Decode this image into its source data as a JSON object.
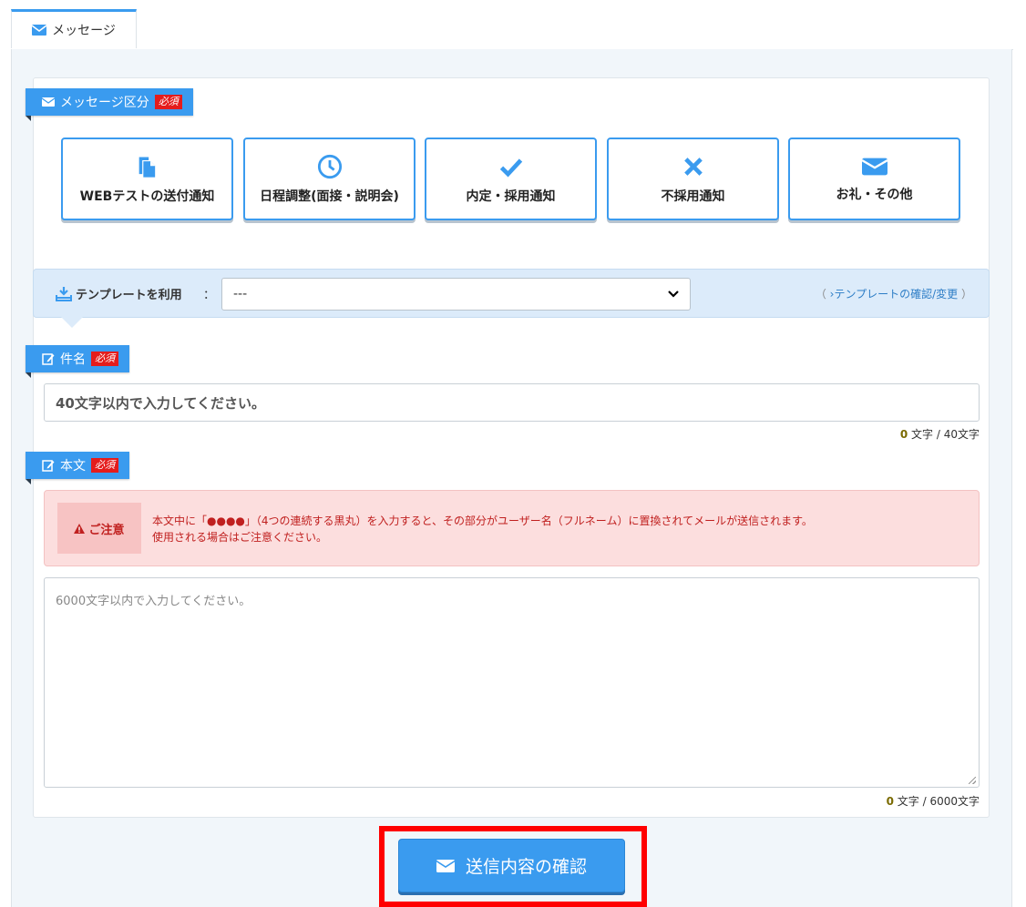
{
  "tabs": [
    {
      "label": "メッセージ",
      "icon": "envelope-icon",
      "active": true
    }
  ],
  "message_type": {
    "label": "メッセージ区分",
    "required": "必須",
    "options": [
      {
        "label": "WEBテストの送付通知",
        "icon": "document-copy-icon"
      },
      {
        "label": "日程調整(面接・説明会)",
        "icon": "clock-icon"
      },
      {
        "label": "内定・採用通知",
        "icon": "check-icon"
      },
      {
        "label": "不採用通知",
        "icon": "x-icon"
      },
      {
        "label": "お礼・その他",
        "icon": "envelope-icon"
      }
    ]
  },
  "template": {
    "label": "テンプレートを利用",
    "colon": "：",
    "selected": "---",
    "link_text": "テンプレートの確認/変更",
    "link_open": "（ ",
    "link_close": " ）"
  },
  "subject": {
    "label": "件名",
    "required": "必須",
    "placeholder": "40文字以内で入力してください。",
    "count": "0",
    "limit_suffix": " 文字 / 40文字"
  },
  "body": {
    "label": "本文",
    "required": "必須",
    "notice_title": "ご注意",
    "notice_line1": "本文中に「●●●●」（4つの連続する黒丸）を入力すると、その部分がユーザー名（フルネーム）に置換されてメールが送信されます。",
    "notice_line2": "使用される場合はご注意ください。",
    "placeholder": "6000文字以内で入力してください。",
    "count": "0",
    "limit_suffix": " 文字 / 6000文字"
  },
  "submit": {
    "label": "送信内容の確認",
    "icon": "envelope-icon"
  },
  "colors": {
    "accent": "#3a9bef",
    "required": "#e51c1c",
    "notice_bg": "#fcdede",
    "highlight": "#ff0000"
  }
}
